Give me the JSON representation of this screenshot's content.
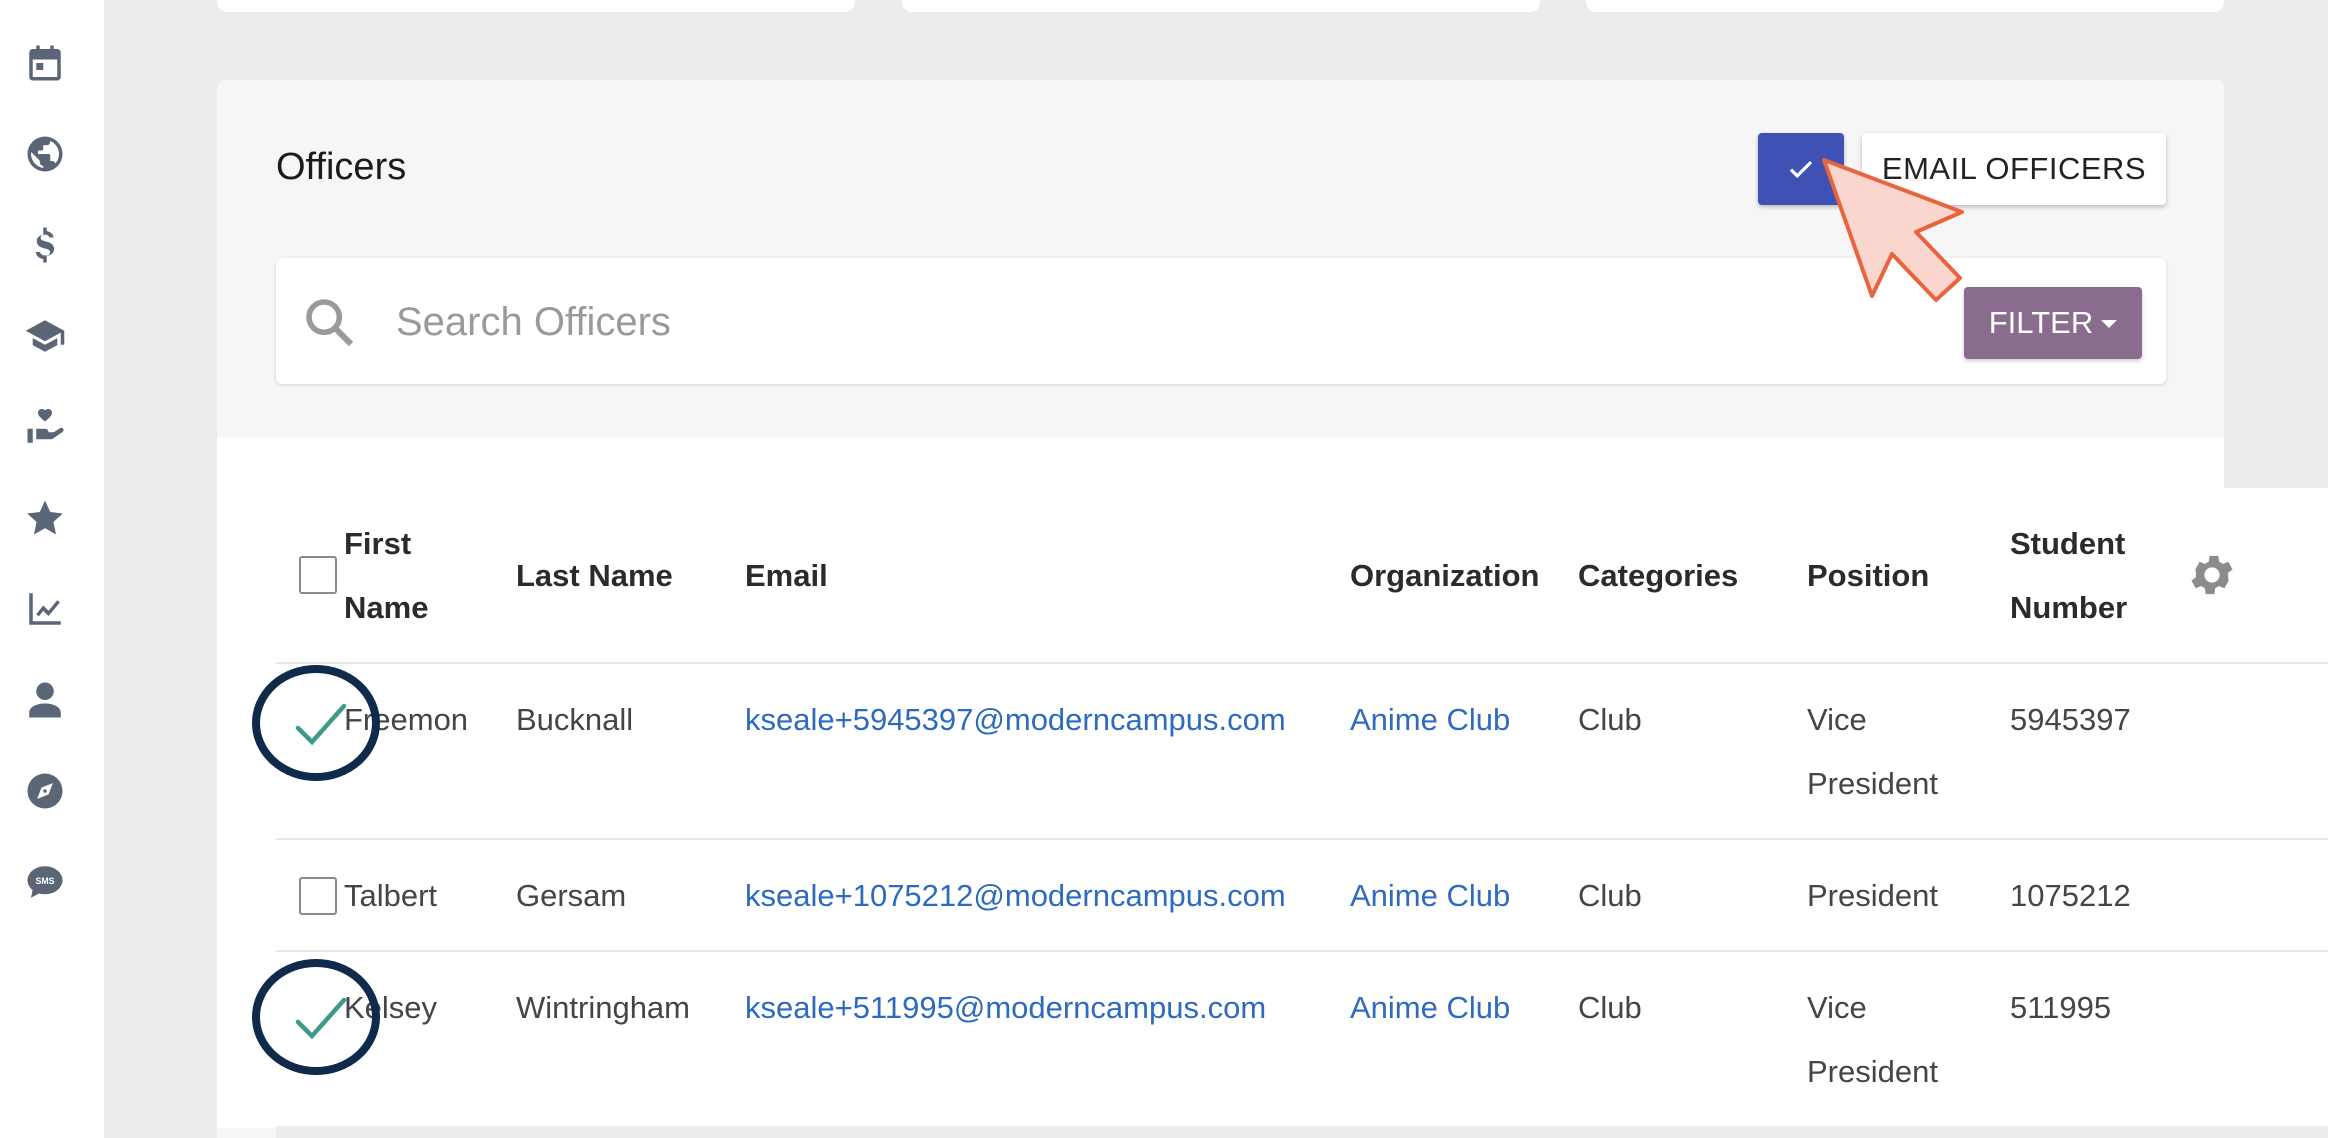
{
  "header": {
    "title": "Officers",
    "email_button_label": "EMAIL OFFICERS"
  },
  "search": {
    "placeholder": "Search Officers"
  },
  "filter": {
    "label": "FILTER"
  },
  "sidebar": {
    "icons": [
      "calendar-icon",
      "globe-icon",
      "dollar-icon",
      "graduation-cap-icon",
      "hand-heart-icon",
      "star-icon",
      "chart-line-icon",
      "user-icon",
      "compass-icon",
      "sms-icon"
    ]
  },
  "table": {
    "columns": {
      "first_name": "First Name",
      "last_name": "Last Name",
      "email": "Email",
      "organization": "Organization",
      "categories": "Categories",
      "position": "Position",
      "student_number": "Student Number"
    },
    "rows": [
      {
        "first_name": "Freemon",
        "last_name": "Bucknall",
        "email": "kseale+5945397@moderncampus.com",
        "organization": "Anime Club",
        "categories": "Club",
        "position": "Vice President",
        "student_number": "5945397",
        "selected": true
      },
      {
        "first_name": "Talbert",
        "last_name": "Gersam",
        "email": "kseale+1075212@moderncampus.com",
        "organization": "Anime Club",
        "categories": "Club",
        "position": "President",
        "student_number": "1075212",
        "selected": false
      },
      {
        "first_name": "Kelsey",
        "last_name": "Wintringham",
        "email": "kseale+511995@moderncampus.com",
        "organization": "Anime Club",
        "categories": "Club",
        "position": "Vice President",
        "student_number": "511995",
        "selected": true
      }
    ]
  },
  "colors": {
    "primary": "#3f51b5",
    "filter": "#8a6c8f",
    "link": "#2d6bbf",
    "annotation_circle": "#0f2a4a",
    "annotation_check": "#3d9a8b",
    "cursor_fill": "#fbd6cf",
    "cursor_stroke": "#e8643f"
  }
}
